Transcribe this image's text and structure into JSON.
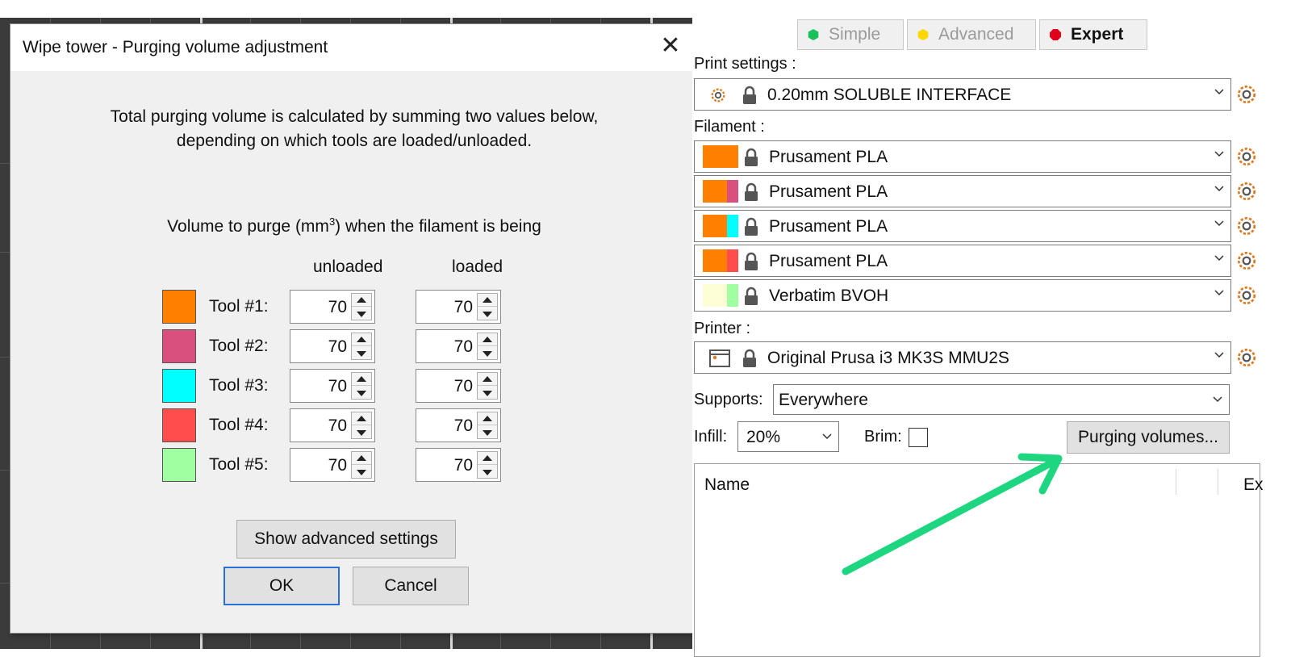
{
  "dialog": {
    "title": "Wipe tower - Purging volume adjustment",
    "close_glyph": "✕",
    "description_line1": "Total purging volume is calculated by summing two values below,",
    "description_line2": "depending on which tools are loaded/unloaded.",
    "volume_label_prefix": "Volume to purge (mm",
    "volume_label_sup": "3",
    "volume_label_suffix": ") when the filament is being",
    "col_unloaded": "unloaded",
    "col_loaded": "loaded",
    "tools": [
      {
        "label": "Tool #1:",
        "color": "#ff7f00",
        "unloaded": "70",
        "loaded": "70"
      },
      {
        "label": "Tool #2:",
        "color": "#d9507f",
        "unloaded": "70",
        "loaded": "70"
      },
      {
        "label": "Tool #3:",
        "color": "#00ffff",
        "unloaded": "70",
        "loaded": "70"
      },
      {
        "label": "Tool #4:",
        "color": "#ff4c4c",
        "unloaded": "70",
        "loaded": "70"
      },
      {
        "label": "Tool #5:",
        "color": "#a0ffa0",
        "unloaded": "70",
        "loaded": "70"
      }
    ],
    "advanced_button": "Show advanced settings",
    "ok_button": "OK",
    "cancel_button": "Cancel"
  },
  "sidebar": {
    "modes": [
      {
        "label": "Simple",
        "color": "#18c05a",
        "active": false
      },
      {
        "label": "Advanced",
        "color": "#ffd700",
        "active": false
      },
      {
        "label": "Expert",
        "color": "#e0001b",
        "active": true
      }
    ],
    "print_settings_label": "Print settings :",
    "print_profile": "0.20mm SOLUBLE INTERFACE",
    "filament_label": "Filament :",
    "filaments": [
      {
        "name": "Prusament PLA",
        "main_color": "#ff7f00",
        "extruder_color": "#ff7f00"
      },
      {
        "name": "Prusament PLA",
        "main_color": "#ff7f00",
        "extruder_color": "#d9507f"
      },
      {
        "name": "Prusament PLA",
        "main_color": "#ff7f00",
        "extruder_color": "#00ffff"
      },
      {
        "name": "Prusament PLA",
        "main_color": "#ff7f00",
        "extruder_color": "#ff4c4c"
      },
      {
        "name": "Verbatim BVOH",
        "main_color": "#fdfdd6",
        "extruder_color": "#a0ffa0"
      }
    ],
    "printer_label": "Printer :",
    "printer_profile": "Original Prusa i3 MK3S MMU2S",
    "supports_label": "Supports:",
    "supports_value": "Everywhere",
    "infill_label": "Infill:",
    "infill_value": "20%",
    "brim_label": "Brim:",
    "brim_checked": false,
    "purging_button": "Purging volumes...",
    "object_list": {
      "col_name": "Name",
      "col_extruder": "Ex"
    }
  },
  "annotation": {
    "arrow_color": "#1ed67f"
  }
}
